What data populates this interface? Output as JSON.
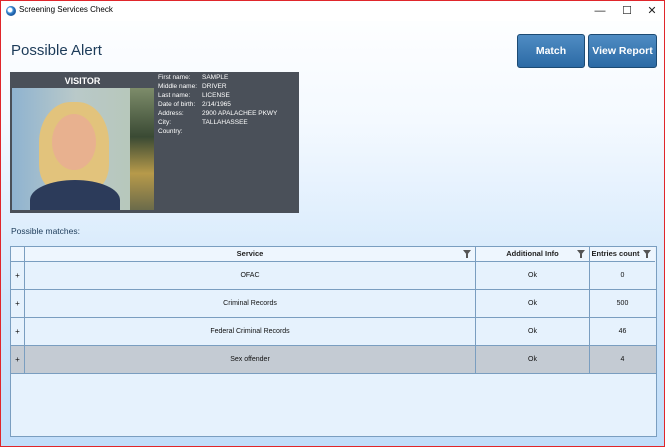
{
  "window": {
    "title": "Screening Services Check"
  },
  "page": {
    "heading": "Possible Alert"
  },
  "actions": {
    "match_label": "Match",
    "report_label": "View Report"
  },
  "visitor": {
    "label": "VISITOR",
    "fields": [
      {
        "key": "First name:",
        "value": "SAMPLE"
      },
      {
        "key": "Middle name:",
        "value": "DRIVER"
      },
      {
        "key": "Last name:",
        "value": "LICENSE"
      },
      {
        "key": "Date of birth:",
        "value": "2/14/1965"
      },
      {
        "key": "Address:",
        "value": "2900 APALACHEE PKWY"
      },
      {
        "key": "City:",
        "value": "TALLAHASSEE"
      },
      {
        "key": "Country:",
        "value": ""
      }
    ]
  },
  "matches": {
    "label": "Possible matches:",
    "columns": [
      "Service",
      "Additional Info",
      "Entries count"
    ],
    "rows": [
      {
        "expand": "+",
        "service": "OFAC",
        "info": "Ok",
        "count": "0"
      },
      {
        "expand": "+",
        "service": "Criminal Records",
        "info": "Ok",
        "count": "500"
      },
      {
        "expand": "+",
        "service": "Federal Criminal Records",
        "info": "Ok",
        "count": "46"
      },
      {
        "expand": "+",
        "service": "Sex offender",
        "info": "Ok",
        "count": "4"
      }
    ],
    "selected_row": 3
  }
}
